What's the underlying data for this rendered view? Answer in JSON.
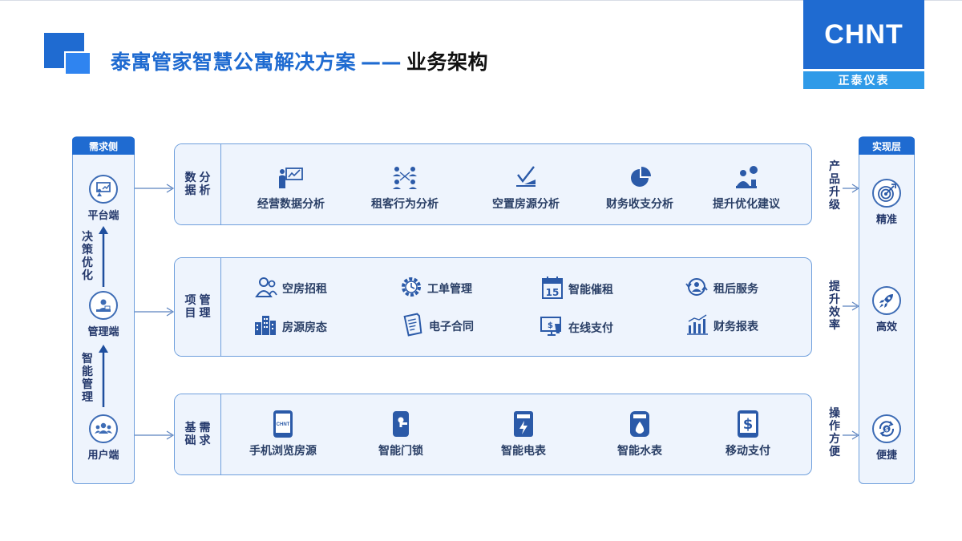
{
  "header": {
    "title_main": "泰寓管家智慧公寓解决方案",
    "title_dash": "——",
    "title_sub": "业务架构"
  },
  "logo": {
    "brand": "CHNT",
    "cn": "正泰仪表"
  },
  "colors": {
    "primary": "#1f6bd1",
    "accent": "#2f9ae8",
    "border": "#6f9fdc",
    "panel_bg": "#eef4fd",
    "text": "#23376a"
  },
  "left_column": {
    "header": "需求侧",
    "nodes": [
      {
        "label": "平台端",
        "icon": "presentation-icon"
      },
      {
        "label": "管理端",
        "icon": "manager-icon"
      },
      {
        "label": "用户端",
        "icon": "users-icon"
      }
    ],
    "arrow_labels": [
      "决策优化",
      "智能管理"
    ]
  },
  "right_column": {
    "header": "实现层",
    "nodes": [
      {
        "label": "精准",
        "icon": "target-icon"
      },
      {
        "label": "高效",
        "icon": "rocket-icon"
      },
      {
        "label": "便捷",
        "icon": "cycle-dollar-icon"
      }
    ]
  },
  "rows": [
    {
      "tab": [
        "分析",
        "数据"
      ],
      "outcome": "产品升级",
      "features": [
        {
          "label": "经营数据分析",
          "icon": "data-analysis-icon"
        },
        {
          "label": "租客行为分析",
          "icon": "network-people-icon"
        },
        {
          "label": "空置房源分析",
          "icon": "vacancy-chart-icon"
        },
        {
          "label": "财务收支分析",
          "icon": "pie-chart-icon"
        },
        {
          "label": "提升优化建议",
          "icon": "advice-icon"
        }
      ]
    },
    {
      "tab": [
        "管理",
        "项目"
      ],
      "outcome": "提升效率",
      "features": [
        {
          "label": "空房招租",
          "icon": "tenant-icon"
        },
        {
          "label": "工单管理",
          "icon": "gear-clock-icon"
        },
        {
          "label": "智能催租",
          "icon": "calendar-icon",
          "icon_text": "15"
        },
        {
          "label": "租后服务",
          "icon": "service-icon"
        },
        {
          "label": "房源房态",
          "icon": "buildings-icon"
        },
        {
          "label": "电子合同",
          "icon": "contract-icon"
        },
        {
          "label": "在线支付",
          "icon": "online-pay-icon"
        },
        {
          "label": "财务报表",
          "icon": "bar-chart-icon"
        }
      ]
    },
    {
      "tab": [
        "需求",
        "基础"
      ],
      "outcome": "操作方便",
      "features": [
        {
          "label": "手机浏览房源",
          "icon": "phone-icon",
          "icon_text": "CHNT"
        },
        {
          "label": "智能门锁",
          "icon": "door-lock-icon"
        },
        {
          "label": "智能电表",
          "icon": "electric-meter-icon"
        },
        {
          "label": "智能水表",
          "icon": "water-meter-icon"
        },
        {
          "label": "移动支付",
          "icon": "mobile-pay-icon",
          "icon_text": "$"
        }
      ]
    }
  ]
}
